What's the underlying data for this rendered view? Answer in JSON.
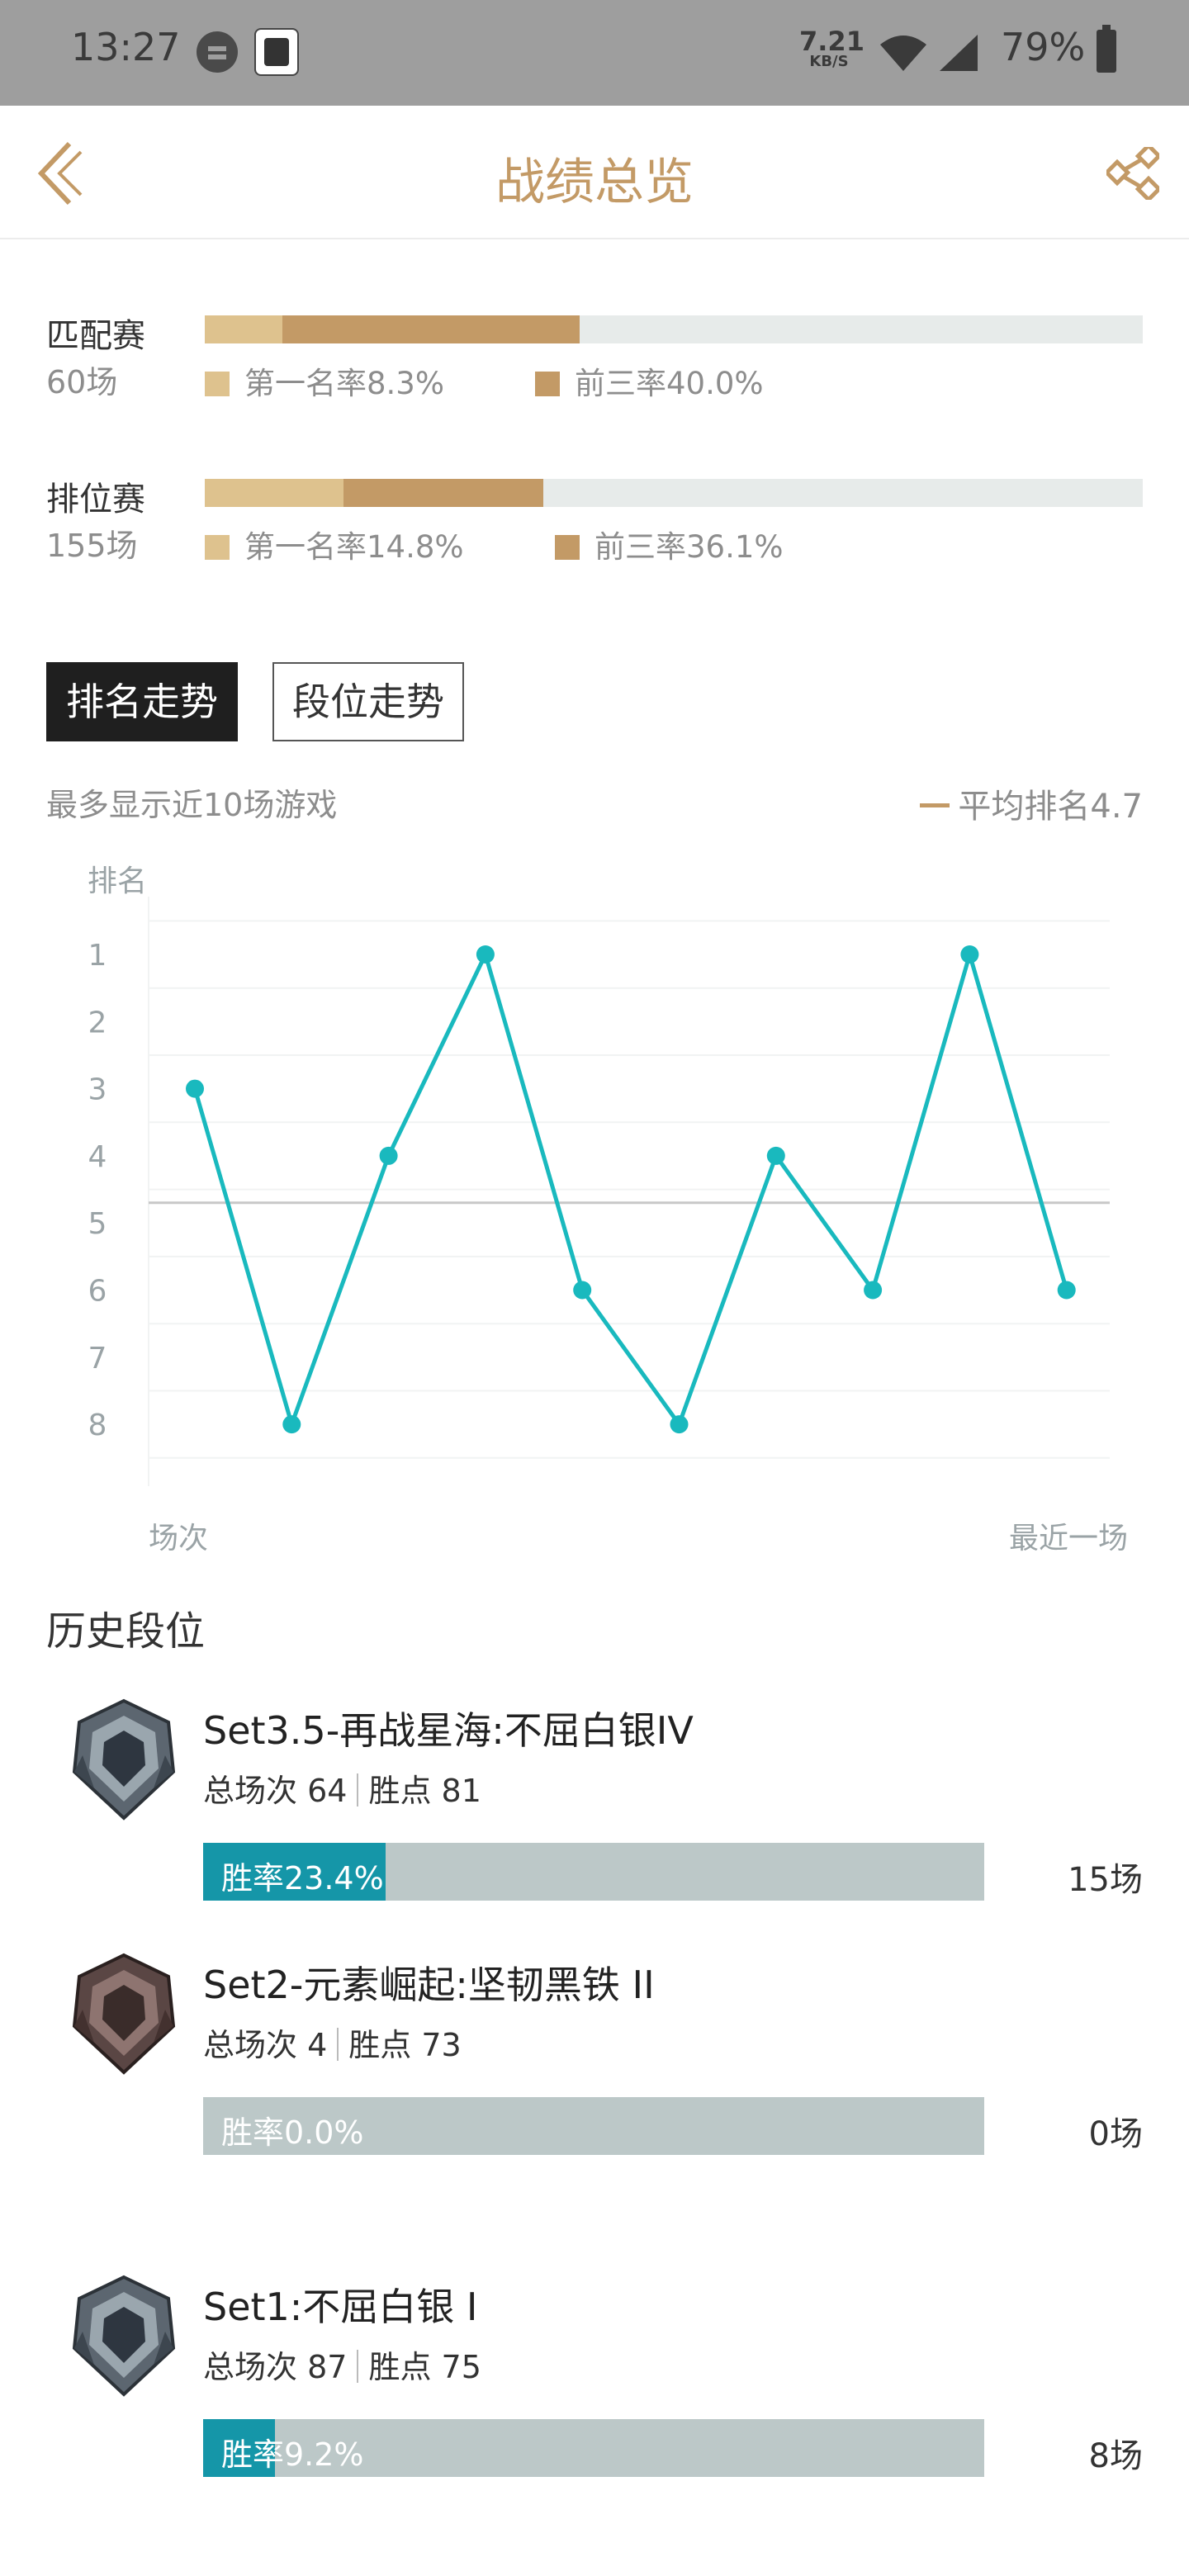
{
  "status_bar": {
    "time": "13:27",
    "net_speed": "7.21",
    "net_unit": "KB/S",
    "battery": "79%",
    "icons": [
      "chat-icon",
      "app-notification-icon",
      "wifi-icon",
      "cell-signal-icon",
      "battery-icon"
    ]
  },
  "header": {
    "title": "战绩总览",
    "back_icon": "chevron-left-icon",
    "share_icon": "share-icon"
  },
  "colors": {
    "accent": "#c39a66",
    "first_rate": "#dec28e",
    "top3_rate": "#c39a66",
    "line": "#19b9be",
    "winbar_fill": "#1596a8",
    "winbar_track": "#bcc8c8"
  },
  "modes": [
    {
      "name": "匹配赛",
      "count": "60场",
      "first_label": "第一名率8.3%",
      "top3_label": "前三率40.0%",
      "first_rate": 8.3,
      "top3_rate": 40.0
    },
    {
      "name": "排位赛",
      "count": "155场",
      "first_label": "第一名率14.8%",
      "top3_label": "前三率36.1%",
      "first_rate": 14.8,
      "top3_rate": 36.1
    }
  ],
  "tabs": [
    {
      "label": "排名走势",
      "active": true
    },
    {
      "label": "段位走势",
      "active": false
    }
  ],
  "trend": {
    "note": "最多显示近10场游戏",
    "avg_label": "平均排名4.7"
  },
  "chart_data": {
    "type": "line",
    "ylabel": "排名",
    "xlabel_start": "场次",
    "xlabel_end": "最近一场",
    "y_ticks": [
      "1",
      "2",
      "3",
      "4",
      "5",
      "6",
      "7",
      "8"
    ],
    "ylim": [
      1,
      8
    ],
    "y_inverted": true,
    "average": 4.7,
    "series": [
      {
        "values": [
          3,
          8,
          4,
          1,
          6,
          8,
          4,
          6,
          1,
          6
        ]
      }
    ],
    "grid": true
  },
  "history": {
    "title": "历史段位",
    "seasons": [
      {
        "name": "Set3.5-再战星海:不屈白银IV",
        "total_label": "总场次 64",
        "points_label": "胜点 81",
        "win_label": "胜率23.4%",
        "win_rate": 23.4,
        "games": "15场",
        "emblem": "silver-rank-emblem-icon"
      },
      {
        "name": "Set2-元素崛起:坚韧黑铁 II",
        "total_label": "总场次 4",
        "points_label": "胜点 73",
        "win_label": "胜率0.0%",
        "win_rate": 0.0,
        "games": "0场",
        "emblem": "iron-rank-emblem-icon"
      },
      {
        "name": "Set1:不屈白银 I",
        "total_label": "总场次 87",
        "points_label": "胜点 75",
        "win_label": "胜率9.2%",
        "win_rate": 9.2,
        "games": "8场",
        "emblem": "silver-rank-emblem-icon"
      }
    ]
  }
}
